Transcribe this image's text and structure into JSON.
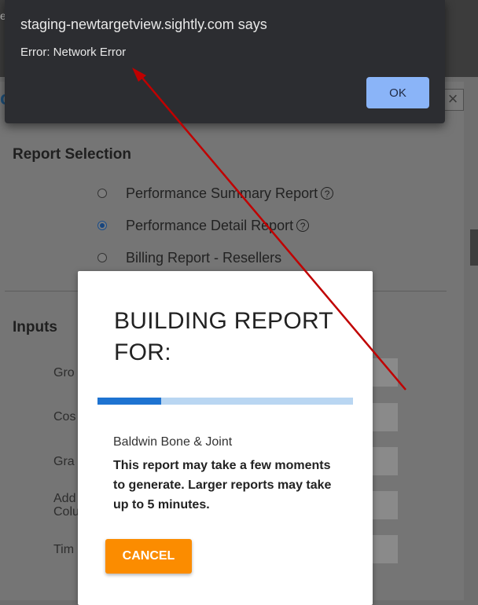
{
  "alert": {
    "title": "staging-newtargetview.sightly.com says",
    "message": "Error: Network Error",
    "ok_label": "OK"
  },
  "background_page": {
    "edge_text": "el",
    "close_icon": "close-icon",
    "report_selection_title": "Report Selection",
    "report_options": [
      {
        "label": "Performance Summary Report",
        "checked": false,
        "help": true
      },
      {
        "label": "Performance Detail Report",
        "checked": true,
        "help": true
      },
      {
        "label": "Billing Report - Resellers",
        "checked": false,
        "help": false
      }
    ],
    "inputs_title": "Inputs",
    "input_labels": [
      "Gro",
      "Cos",
      "Gra",
      "Add",
      "Colu",
      "Tim"
    ]
  },
  "report_dialog": {
    "title": "BUILDING REPORT FOR:",
    "progress": 0.25,
    "client_name": "Baldwin Bone & Joint",
    "note": "This report may take a few moments to generate. Larger reports may take up to 5 minutes.",
    "cancel_label": "CANCEL"
  },
  "colors": {
    "accent_orange": "#fb8c00",
    "progress_fill": "#1e73d1",
    "progress_track": "#b9d6f2",
    "alert_bg": "#2c2d31",
    "alert_button": "#8ab4f8",
    "annotation_arrow": "#c00000"
  }
}
